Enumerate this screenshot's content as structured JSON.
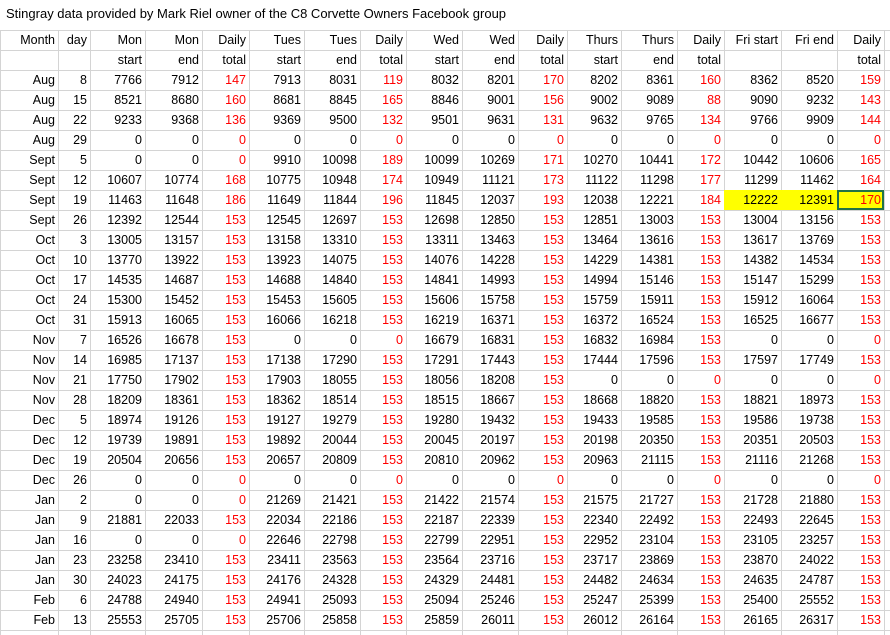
{
  "sheet": {
    "title": "Stingray data provided by Mark Riel owner of the C8 Corvette Owners Facebook group",
    "header_top": [
      "Month",
      "day",
      "Mon",
      "Mon",
      "Daily",
      "Tues",
      "Tues",
      "Daily",
      "Wed",
      "Wed",
      "Daily",
      "Thurs",
      "Thurs",
      "Daily",
      "Fri start",
      "Fri end",
      "Daily"
    ],
    "header_bottom": [
      "",
      "",
      "start",
      "end",
      "total",
      "start",
      "end",
      "total",
      "start",
      "end",
      "total",
      "start",
      "end",
      "total",
      "",
      "",
      "total"
    ],
    "rows": [
      [
        "Aug",
        "8",
        "7766",
        "7912",
        "147",
        "7913",
        "8031",
        "119",
        "8032",
        "8201",
        "170",
        "8202",
        "8361",
        "160",
        "8362",
        "8520",
        "159"
      ],
      [
        "Aug",
        "15",
        "8521",
        "8680",
        "160",
        "8681",
        "8845",
        "165",
        "8846",
        "9001",
        "156",
        "9002",
        "9089",
        "88",
        "9090",
        "9232",
        "143"
      ],
      [
        "Aug",
        "22",
        "9233",
        "9368",
        "136",
        "9369",
        "9500",
        "132",
        "9501",
        "9631",
        "131",
        "9632",
        "9765",
        "134",
        "9766",
        "9909",
        "144"
      ],
      [
        "Aug",
        "29",
        "0",
        "0",
        "0",
        "0",
        "0",
        "0",
        "0",
        "0",
        "0",
        "0",
        "0",
        "0",
        "0",
        "0",
        "0"
      ],
      [
        "Sept",
        "5",
        "0",
        "0",
        "0",
        "9910",
        "10098",
        "189",
        "10099",
        "10269",
        "171",
        "10270",
        "10441",
        "172",
        "10442",
        "10606",
        "165"
      ],
      [
        "Sept",
        "12",
        "10607",
        "10774",
        "168",
        "10775",
        "10948",
        "174",
        "10949",
        "11121",
        "173",
        "11122",
        "11298",
        "177",
        "11299",
        "11462",
        "164"
      ],
      [
        "Sept",
        "19",
        "11463",
        "11648",
        "186",
        "11649",
        "11844",
        "196",
        "11845",
        "12037",
        "193",
        "12038",
        "12221",
        "184",
        "12222",
        "12391",
        "170"
      ],
      [
        "Sept",
        "26",
        "12392",
        "12544",
        "153",
        "12545",
        "12697",
        "153",
        "12698",
        "12850",
        "153",
        "12851",
        "13003",
        "153",
        "13004",
        "13156",
        "153"
      ],
      [
        "Oct",
        "3",
        "13005",
        "13157",
        "153",
        "13158",
        "13310",
        "153",
        "13311",
        "13463",
        "153",
        "13464",
        "13616",
        "153",
        "13617",
        "13769",
        "153"
      ],
      [
        "Oct",
        "10",
        "13770",
        "13922",
        "153",
        "13923",
        "14075",
        "153",
        "14076",
        "14228",
        "153",
        "14229",
        "14381",
        "153",
        "14382",
        "14534",
        "153"
      ],
      [
        "Oct",
        "17",
        "14535",
        "14687",
        "153",
        "14688",
        "14840",
        "153",
        "14841",
        "14993",
        "153",
        "14994",
        "15146",
        "153",
        "15147",
        "15299",
        "153"
      ],
      [
        "Oct",
        "24",
        "15300",
        "15452",
        "153",
        "15453",
        "15605",
        "153",
        "15606",
        "15758",
        "153",
        "15759",
        "15911",
        "153",
        "15912",
        "16064",
        "153"
      ],
      [
        "Oct",
        "31",
        "15913",
        "16065",
        "153",
        "16066",
        "16218",
        "153",
        "16219",
        "16371",
        "153",
        "16372",
        "16524",
        "153",
        "16525",
        "16677",
        "153"
      ],
      [
        "Nov",
        "7",
        "16526",
        "16678",
        "153",
        "0",
        "0",
        "0",
        "16679",
        "16831",
        "153",
        "16832",
        "16984",
        "153",
        "0",
        "0",
        "0"
      ],
      [
        "Nov",
        "14",
        "16985",
        "17137",
        "153",
        "17138",
        "17290",
        "153",
        "17291",
        "17443",
        "153",
        "17444",
        "17596",
        "153",
        "17597",
        "17749",
        "153"
      ],
      [
        "Nov",
        "21",
        "17750",
        "17902",
        "153",
        "17903",
        "18055",
        "153",
        "18056",
        "18208",
        "153",
        "0",
        "0",
        "0",
        "0",
        "0",
        "0"
      ],
      [
        "Nov",
        "28",
        "18209",
        "18361",
        "153",
        "18362",
        "18514",
        "153",
        "18515",
        "18667",
        "153",
        "18668",
        "18820",
        "153",
        "18821",
        "18973",
        "153"
      ],
      [
        "Dec",
        "5",
        "18974",
        "19126",
        "153",
        "19127",
        "19279",
        "153",
        "19280",
        "19432",
        "153",
        "19433",
        "19585",
        "153",
        "19586",
        "19738",
        "153"
      ],
      [
        "Dec",
        "12",
        "19739",
        "19891",
        "153",
        "19892",
        "20044",
        "153",
        "20045",
        "20197",
        "153",
        "20198",
        "20350",
        "153",
        "20351",
        "20503",
        "153"
      ],
      [
        "Dec",
        "19",
        "20504",
        "20656",
        "153",
        "20657",
        "20809",
        "153",
        "20810",
        "20962",
        "153",
        "20963",
        "21115",
        "153",
        "21116",
        "21268",
        "153"
      ],
      [
        "Dec",
        "26",
        "0",
        "0",
        "0",
        "0",
        "0",
        "0",
        "0",
        "0",
        "0",
        "0",
        "0",
        "0",
        "0",
        "0",
        "0"
      ],
      [
        "Jan",
        "2",
        "0",
        "0",
        "0",
        "21269",
        "21421",
        "153",
        "21422",
        "21574",
        "153",
        "21575",
        "21727",
        "153",
        "21728",
        "21880",
        "153"
      ],
      [
        "Jan",
        "9",
        "21881",
        "22033",
        "153",
        "22034",
        "22186",
        "153",
        "22187",
        "22339",
        "153",
        "22340",
        "22492",
        "153",
        "22493",
        "22645",
        "153"
      ],
      [
        "Jan",
        "16",
        "0",
        "0",
        "0",
        "22646",
        "22798",
        "153",
        "22799",
        "22951",
        "153",
        "22952",
        "23104",
        "153",
        "23105",
        "23257",
        "153"
      ],
      [
        "Jan",
        "23",
        "23258",
        "23410",
        "153",
        "23411",
        "23563",
        "153",
        "23564",
        "23716",
        "153",
        "23717",
        "23869",
        "153",
        "23870",
        "24022",
        "153"
      ],
      [
        "Jan",
        "30",
        "24023",
        "24175",
        "153",
        "24176",
        "24328",
        "153",
        "24329",
        "24481",
        "153",
        "24482",
        "24634",
        "153",
        "24635",
        "24787",
        "153"
      ],
      [
        "Feb",
        "6",
        "24788",
        "24940",
        "153",
        "24941",
        "25093",
        "153",
        "25094",
        "25246",
        "153",
        "25247",
        "25399",
        "153",
        "25400",
        "25552",
        "153"
      ],
      [
        "Feb",
        "13",
        "25553",
        "25705",
        "153",
        "25706",
        "25858",
        "153",
        "25859",
        "26011",
        "153",
        "26012",
        "26164",
        "153",
        "26165",
        "26317",
        "153"
      ]
    ],
    "highlight": {
      "row": 6,
      "cols": [
        14,
        15,
        16
      ],
      "color": "#ffff00",
      "selected_col": 16
    },
    "colors": {
      "daily_total_text": "#ff0000",
      "cell_text": "#000000",
      "gridline": "#d4d4d4",
      "selection_border": "#217346"
    }
  }
}
